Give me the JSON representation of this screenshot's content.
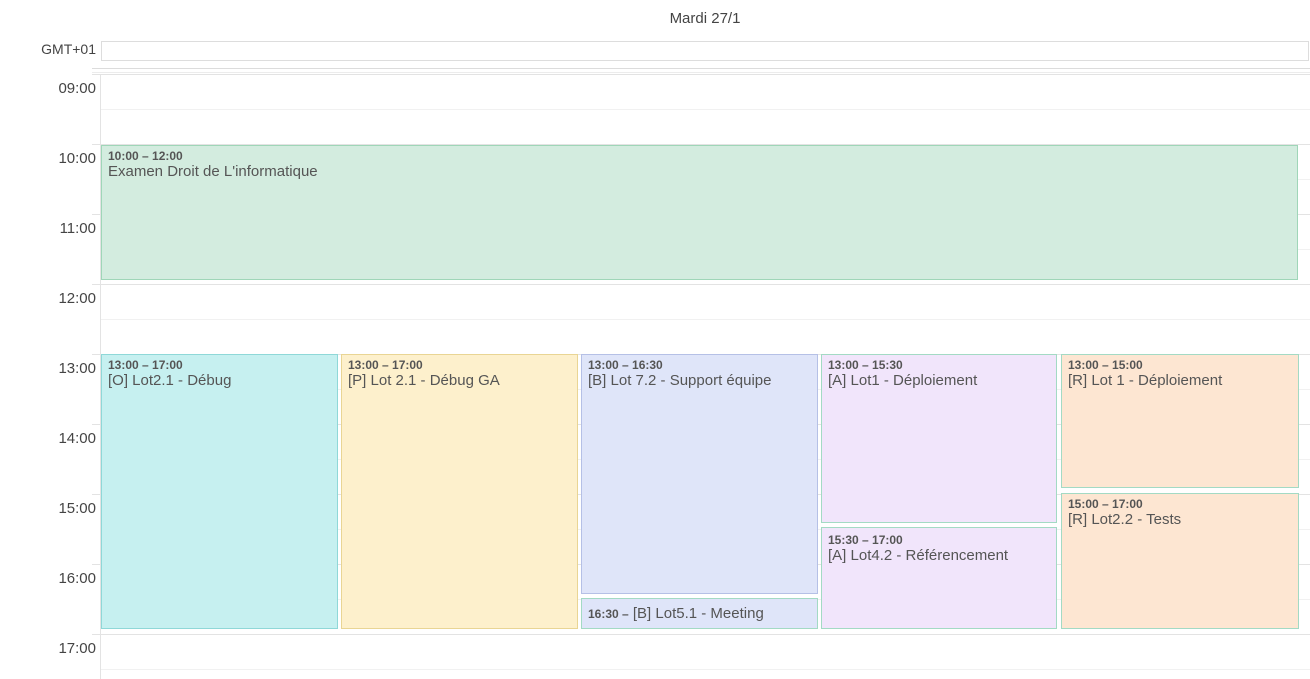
{
  "header": {
    "day_label": "Mardi 27/1",
    "timezone": "GMT+01"
  },
  "hours": [
    "09:00",
    "10:00",
    "11:00",
    "12:00",
    "13:00",
    "14:00",
    "15:00",
    "16:00",
    "17:00"
  ],
  "events": [
    {
      "time": "10:00 – 12:00",
      "title": "Examen Droit de L'informatique",
      "color": "#d3ecdf"
    },
    {
      "time": "13:00 – 17:00",
      "title": "[O] Lot2.1 - Débug",
      "color": "#c6f0f0"
    },
    {
      "time": "13:00 – 17:00",
      "title": "[P] Lot 2.1 - Débug GA",
      "color": "#fdf0cc"
    },
    {
      "time": "13:00 – 16:30",
      "title": "[B] Lot 7.2 - Support équipe",
      "color": "#dfe5f9"
    },
    {
      "time": "16:30 –",
      "title": "[B] Lot5.1 - Meeting",
      "color": "#dfe5f9"
    },
    {
      "time": "13:00 – 15:30",
      "title": "[A] Lot1 - Déploiement",
      "color": "#f1e5fb"
    },
    {
      "time": "15:30 – 17:00",
      "title": "[A] Lot4.2 - Référencement",
      "color": "#f1e5fb"
    },
    {
      "time": "13:00 – 15:00",
      "title": "[R] Lot 1 - Déploiement",
      "color": "#fde6d2"
    },
    {
      "time": "15:00 – 17:00",
      "title": "[R] Lot2.2 - Tests",
      "color": "#fde6d2"
    }
  ]
}
